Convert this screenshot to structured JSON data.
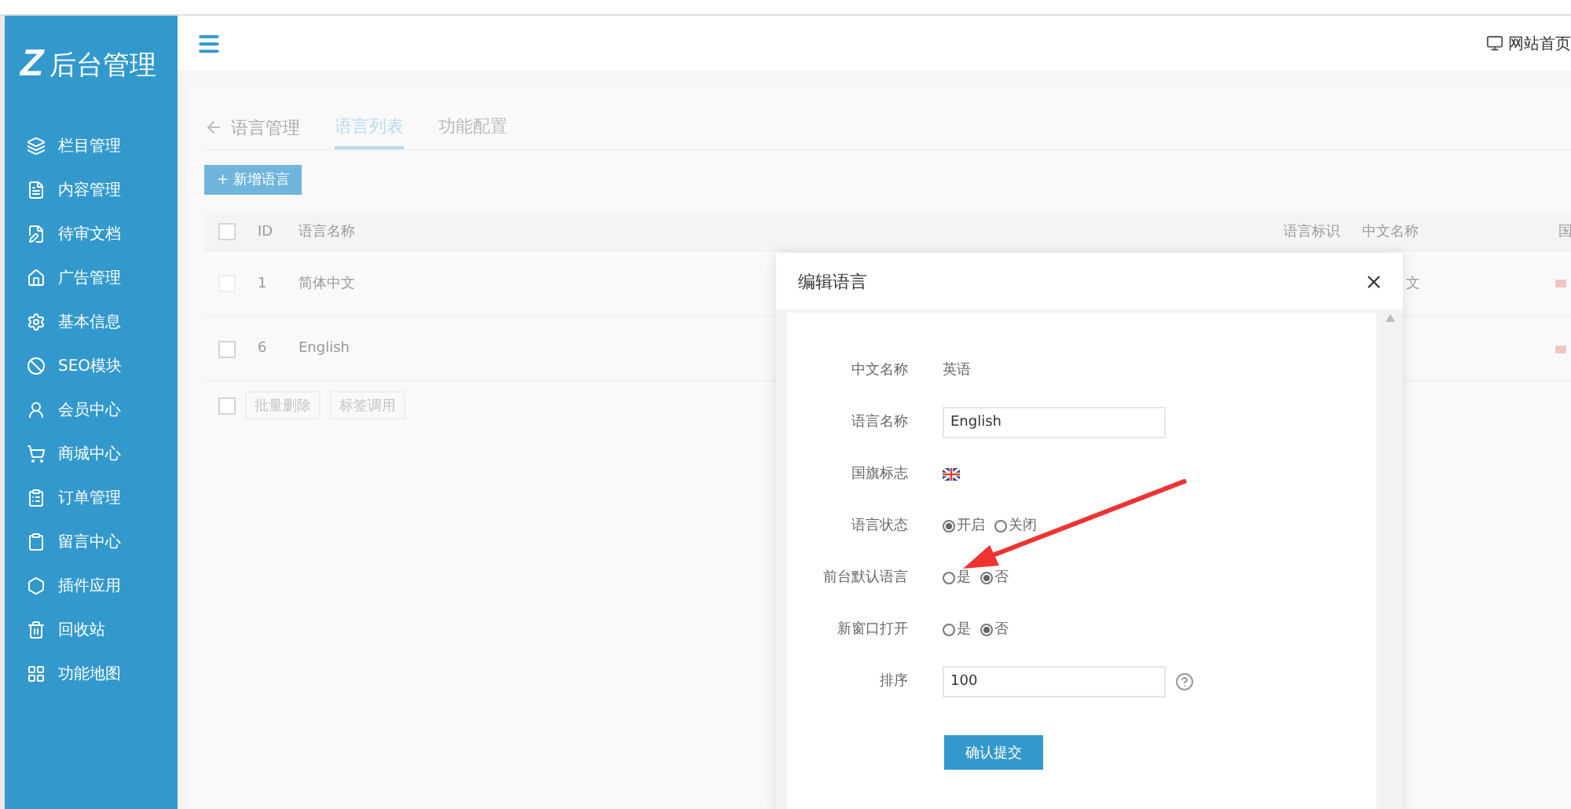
{
  "sidebar": {
    "logo_mark": "Z",
    "logo_text": "后台管理",
    "items": [
      {
        "label": "栏目管理"
      },
      {
        "label": "内容管理"
      },
      {
        "label": "待审文档"
      },
      {
        "label": "广告管理"
      },
      {
        "label": "基本信息"
      },
      {
        "label": "SEO模块"
      },
      {
        "label": "会员中心"
      },
      {
        "label": "商城中心"
      },
      {
        "label": "订单管理"
      },
      {
        "label": "留言中心"
      },
      {
        "label": "插件应用"
      },
      {
        "label": "回收站"
      },
      {
        "label": "功能地图"
      }
    ]
  },
  "header": {
    "website_link": "网站首页"
  },
  "page": {
    "back_label": "语言管理",
    "tabs": [
      {
        "label": "语言列表",
        "selected": true
      },
      {
        "label": "功能配置",
        "selected": false
      }
    ],
    "add_button": "+ 新增语言",
    "table": {
      "select_all_checked": false,
      "columns": [
        "ID",
        "语言名称",
        "语言标识",
        "中文名称",
        "国"
      ],
      "rows": [
        {
          "checked": false,
          "disabled": true,
          "id": "1",
          "name": "简体中文",
          "chinese_name": "文"
        },
        {
          "checked": false,
          "disabled": false,
          "id": "6",
          "name": "English",
          "chinese_name": ""
        }
      ]
    },
    "bulk_checked": false,
    "bulk_buttons": [
      "批量删除",
      "标签调用"
    ]
  },
  "dialog": {
    "title": "编辑语言",
    "fields": [
      {
        "kind": "text",
        "label": "中文名称",
        "value": "英语"
      },
      {
        "kind": "input",
        "label": "语言名称",
        "value": "English",
        "help": false
      },
      {
        "kind": "flag",
        "label": "国旗标志"
      },
      {
        "kind": "radio",
        "label": "语言状态",
        "options": [
          {
            "label": "开启",
            "selected": true
          },
          {
            "label": "关闭",
            "selected": false
          }
        ]
      },
      {
        "kind": "radio",
        "label": "前台默认语言",
        "options": [
          {
            "label": "是",
            "selected": false
          },
          {
            "label": "否",
            "selected": true
          }
        ]
      },
      {
        "kind": "radio",
        "label": "新窗口打开",
        "options": [
          {
            "label": "是",
            "selected": false
          },
          {
            "label": "否",
            "selected": true
          }
        ]
      },
      {
        "kind": "input",
        "label": "排序",
        "value": "100",
        "help": true
      }
    ],
    "submit": "确认提交"
  }
}
